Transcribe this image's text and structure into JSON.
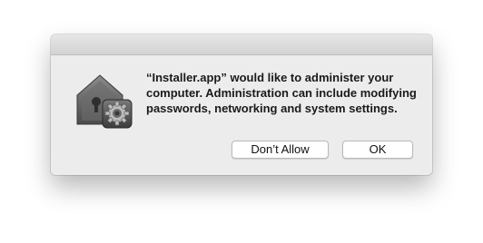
{
  "dialog": {
    "message": "“Installer.app” would like to administer your computer. Administration can include modifying passwords, networking and system settings.",
    "icon": "security-lock-gear-icon",
    "buttons": {
      "deny_label": "Don’t Allow",
      "ok_label": "OK"
    }
  },
  "colors": {
    "dialog_background": "#ececec",
    "button_background": "#ffffff"
  }
}
